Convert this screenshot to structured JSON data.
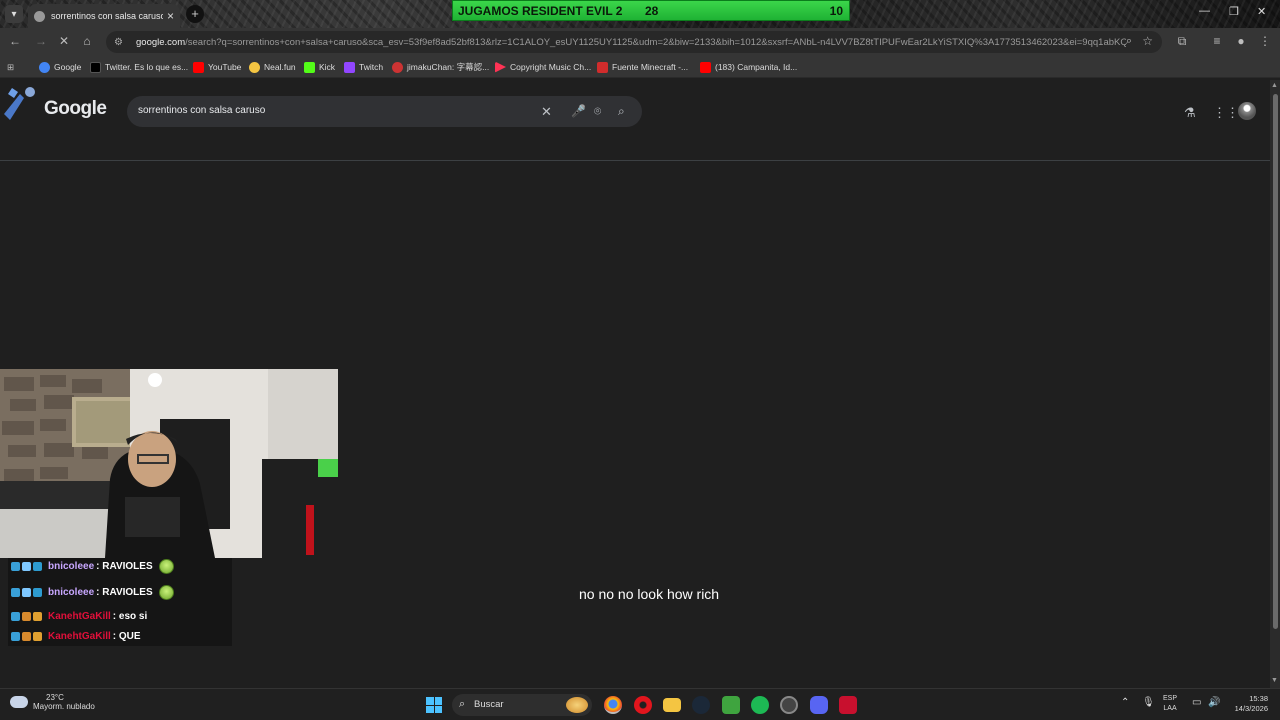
{
  "browser": {
    "tab_title": "sorrentinos con salsa caruso - B",
    "url_host": "google.com",
    "url_rest": "/search?q=sorrentinos+con+salsa+caruso&sca_esv=53f9ef8ad52bf813&rlz=1C1ALOY_esUY1125UY1125&udm=2&biw=2133&bih=1012&sxsrf=ANbL-n4LVV7BZ8tTIPUFwEar2LkYiSTXIQ%3A1773513462023&ei=9qq1abKQAZ6...",
    "bookmarks": [
      {
        "label": "Google",
        "color": "#4285f4"
      },
      {
        "label": "Twitter. Es lo que es...",
        "color": "#000000"
      },
      {
        "label": "YouTube",
        "color": "#ff0000"
      },
      {
        "label": "Neal.fun",
        "color": "#f4c542"
      },
      {
        "label": "Kick",
        "color": "#53fc18"
      },
      {
        "label": "Twitch",
        "color": "#9146ff"
      },
      {
        "label": "jimakuChan: 字幕認...",
        "color": "#cc3333"
      },
      {
        "label": "Copyright Music Ch...",
        "color": "#ff3355"
      },
      {
        "label": "Fuente Minecraft -...",
        "color": "#d12c2c"
      },
      {
        "label": "(183) Campanita, Id...",
        "color": "#ff0000"
      }
    ]
  },
  "stream_overlay": {
    "label": "JUGAMOS RESIDENT EVIL 2",
    "count_1": "28",
    "count_2": "10"
  },
  "google": {
    "logo": "Google",
    "query": "sorrentinos con salsa caruso"
  },
  "caption": "no no no look how rich",
  "chat": [
    {
      "user": "bnicoleee",
      "text": ": RAVIOLES",
      "user_color": "#c8a7ff",
      "emote": true
    },
    {
      "user": "bnicoleee",
      "text": ": RAVIOLES",
      "user_color": "#c8a7ff",
      "emote": true
    },
    {
      "user": "KanehtGaKill",
      "text": ": eso si",
      "user_color": "#e0103a",
      "emote": false
    },
    {
      "user": "KanehtGaKill",
      "text": ": QUE",
      "user_color": "#e0103a",
      "emote": false
    }
  ],
  "taskbar": {
    "temp": "23°C",
    "weather": "Mayorm. nublado",
    "search_label": "Buscar",
    "lang_1": "ESP",
    "lang_2": "LAA",
    "time": "15:38",
    "date": "14/3/2026"
  }
}
